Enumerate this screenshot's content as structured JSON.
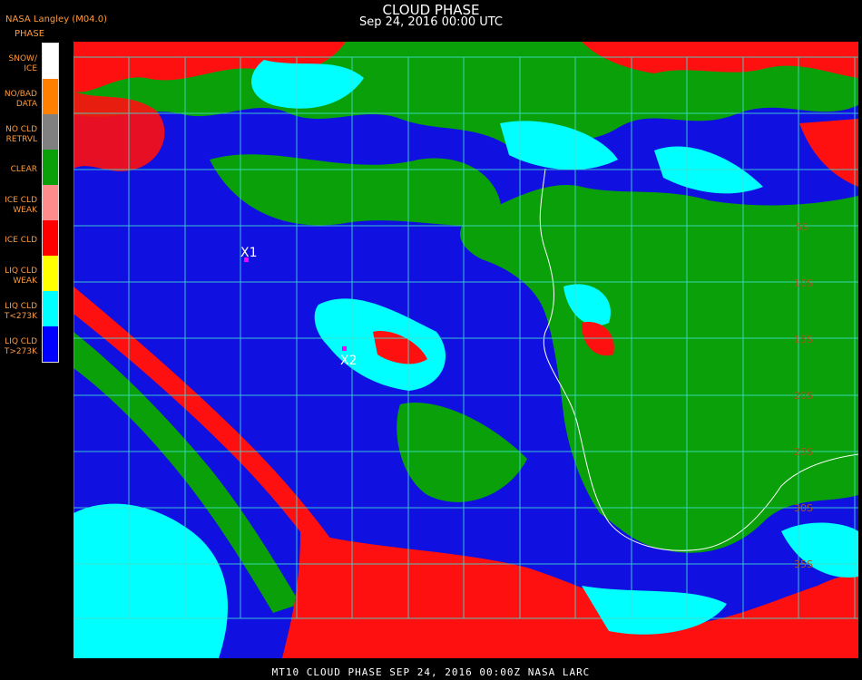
{
  "title": "CLOUD PHASE",
  "subtitle": "Sep 24, 2016 00:00 UTC",
  "producer": "NASA Langley (M04.0)",
  "legend": {
    "title": "PHASE",
    "items": [
      {
        "label": "SNOW/\nICE",
        "color": "#ffffff"
      },
      {
        "label": "NO/BAD\nDATA",
        "color": "#ff8000"
      },
      {
        "label": "NO CLD\nRETRVL",
        "color": "#808080"
      },
      {
        "label": "CLEAR",
        "color": "#0aa00a"
      },
      {
        "label": "ICE CLD\nWEAK",
        "color": "#ff8c8c"
      },
      {
        "label": "ICE CLD",
        "color": "#ff0000"
      },
      {
        "label": "LIQ CLD\nWEAK",
        "color": "#ffff00"
      },
      {
        "label": "LIQ CLD\nT<273K",
        "color": "#00ffff"
      },
      {
        "label": "LIQ CLD\nT>273K",
        "color": "#0000ff"
      }
    ]
  },
  "markers": [
    {
      "label": "X1",
      "color": "#ff00ff"
    },
    {
      "label": "X2",
      "color": "#ff00ff"
    }
  ],
  "latitude_labels": [
    "5S",
    "10S",
    "15S",
    "20S",
    "25S",
    "30S",
    "35S"
  ],
  "footer": "MT10  CLOUD PHASE  SEP 24, 2016 00:00Z  NASA LARC",
  "colors": {
    "clear": "#0aa00a",
    "ice": "#ff0000",
    "liq_warm": "#0000ff",
    "liq_cold": "#00ffff",
    "grid": "#40e0d0",
    "coast": "#ffffff",
    "lat_label": "#a05a1e"
  }
}
